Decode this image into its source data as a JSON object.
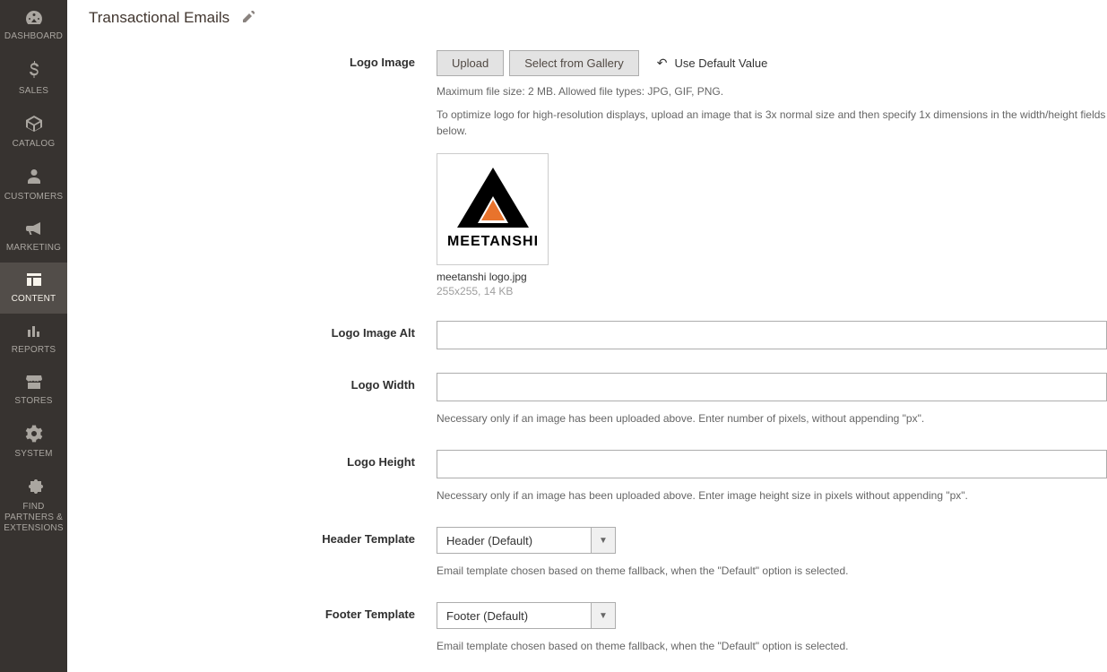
{
  "sidebar": {
    "items": [
      {
        "label": "DASHBOARD",
        "icon": "dashboard"
      },
      {
        "label": "SALES",
        "icon": "dollar"
      },
      {
        "label": "CATALOG",
        "icon": "cube"
      },
      {
        "label": "CUSTOMERS",
        "icon": "person"
      },
      {
        "label": "MARKETING",
        "icon": "megaphone"
      },
      {
        "label": "CONTENT",
        "icon": "layout",
        "active": true
      },
      {
        "label": "REPORTS",
        "icon": "chart"
      },
      {
        "label": "STORES",
        "icon": "store"
      },
      {
        "label": "SYSTEM",
        "icon": "gear"
      },
      {
        "label": "FIND PARTNERS & EXTENSIONS",
        "icon": "puzzle"
      }
    ]
  },
  "page": {
    "title": "Transactional Emails"
  },
  "fields": {
    "logo_image": {
      "label": "Logo Image",
      "upload_label": "Upload",
      "gallery_label": "Select from Gallery",
      "default_label": "Use Default Value",
      "hint1": "Maximum file size: 2 MB. Allowed file types: JPG, GIF, PNG.",
      "hint2": "To optimize logo for high-resolution displays, upload an image that is 3x normal size and then specify 1x dimensions in the width/height fields below.",
      "file_name": "meetanshi logo.jpg",
      "file_meta": "255x255, 14 KB",
      "logo_text": "MEETANSHI"
    },
    "logo_alt": {
      "label": "Logo Image Alt",
      "value": ""
    },
    "logo_width": {
      "label": "Logo Width",
      "value": "",
      "hint": "Necessary only if an image has been uploaded above. Enter number of pixels, without appending \"px\"."
    },
    "logo_height": {
      "label": "Logo Height",
      "value": "",
      "hint": "Necessary only if an image has been uploaded above. Enter image height size in pixels without appending \"px\"."
    },
    "header_template": {
      "label": "Header Template",
      "value": "Header (Default)",
      "hint": "Email template chosen based on theme fallback, when the \"Default\" option is selected."
    },
    "footer_template": {
      "label": "Footer Template",
      "value": "Footer (Default)",
      "hint": "Email template chosen based on theme fallback, when the \"Default\" option is selected."
    }
  }
}
